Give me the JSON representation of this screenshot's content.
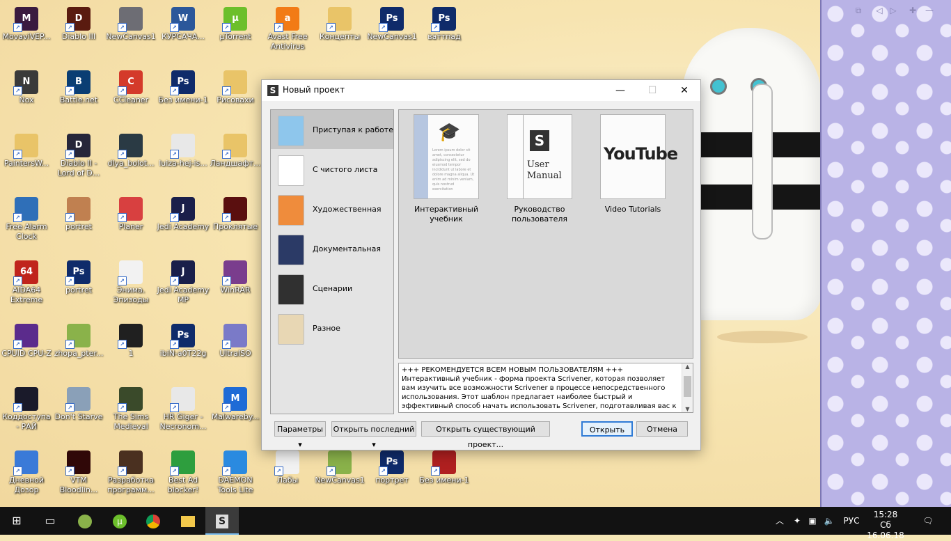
{
  "desktop": {
    "icons": [
      {
        "label": "MovaviVEP...",
        "glyph": "M",
        "color": "#3a1a3f"
      },
      {
        "label": "Diablo III",
        "glyph": "D",
        "color": "#5a1b10"
      },
      {
        "label": "NewCanvas1",
        "glyph": "",
        "color": "#6d6d74"
      },
      {
        "label": "КУРСАЧА...",
        "glyph": "W",
        "color": "#2b579a"
      },
      {
        "label": "µTorrent",
        "glyph": "µ",
        "color": "#6cbf2b"
      },
      {
        "label": "Avast Free Antivirus",
        "glyph": "a",
        "color": "#f27b16"
      },
      {
        "label": "Концепты",
        "glyph": "",
        "color": "#e9c468"
      },
      {
        "label": "NewCanvas1",
        "glyph": "Ps",
        "color": "#0f2b6a"
      },
      {
        "label": "ваттпад",
        "glyph": "Ps",
        "color": "#0f2b6a"
      },
      {
        "label": "Nox",
        "glyph": "N",
        "color": "#3a3a3a"
      },
      {
        "label": "Battle.net",
        "glyph": "B",
        "color": "#0b3e73"
      },
      {
        "label": "CCleaner",
        "glyph": "C",
        "color": "#d43a2a"
      },
      {
        "label": "Без имени-1",
        "glyph": "Ps",
        "color": "#0f2b6a"
      },
      {
        "label": "Рисовахи",
        "glyph": "",
        "color": "#e9c468"
      },
      {
        "label": "PaintersW...",
        "glyph": "",
        "color": "#e9c468"
      },
      {
        "label": "Diablo II - Lord of D...",
        "glyph": "D",
        "color": "#26263a"
      },
      {
        "label": "dlya_bolot...",
        "glyph": "",
        "color": "#2a3a44"
      },
      {
        "label": "luiza-hej-is...",
        "glyph": "",
        "color": "#e8e8e8"
      },
      {
        "label": "Ландшафт...",
        "glyph": "",
        "color": "#e9c468"
      },
      {
        "label": "Free Alarm Clock",
        "glyph": "",
        "color": "#2f6fb8"
      },
      {
        "label": "portret",
        "glyph": "",
        "color": "#c08050"
      },
      {
        "label": "Planer",
        "glyph": "",
        "color": "#d84040"
      },
      {
        "label": "Jedi Academy",
        "glyph": "J",
        "color": "#1a1f4a"
      },
      {
        "label": "Проклятые",
        "glyph": "",
        "color": "#5a0f0f"
      },
      {
        "label": "AIDA64 Extreme",
        "glyph": "64",
        "color": "#c0241c"
      },
      {
        "label": "portret",
        "glyph": "Ps",
        "color": "#0f2b6a"
      },
      {
        "label": "Энима. Эпизоды",
        "glyph": "",
        "color": "#f2f2f2"
      },
      {
        "label": "Jedi Academy MP",
        "glyph": "J",
        "color": "#1a1f4a"
      },
      {
        "label": "WinRAR",
        "glyph": "",
        "color": "#7a3d8d"
      },
      {
        "label": "CPUID CPU-Z",
        "glyph": "",
        "color": "#5b2b8c"
      },
      {
        "label": "zhopa_pter...",
        "glyph": "",
        "color": "#8ab24a"
      },
      {
        "label": "1",
        "glyph": "",
        "color": "#202020"
      },
      {
        "label": "ibiN-a0T22g",
        "glyph": "Ps",
        "color": "#0f2b6a"
      },
      {
        "label": "UltraISO",
        "glyph": "",
        "color": "#7a7ac8"
      },
      {
        "label": "Коддоступа - РАЙ",
        "glyph": "",
        "color": "#1a1a2a"
      },
      {
        "label": "Don't Starve",
        "glyph": "",
        "color": "#8aa0b8"
      },
      {
        "label": "The Sims Medieval",
        "glyph": "",
        "color": "#3a4a2a"
      },
      {
        "label": "HR Giger - Necronom...",
        "glyph": "",
        "color": "#e8e8e8"
      },
      {
        "label": "Malwareby...",
        "glyph": "M",
        "color": "#1e6bd6"
      },
      {
        "label": "Дневной Дозор",
        "glyph": "",
        "color": "#3a7ad8"
      },
      {
        "label": "VTM Bloodlin...",
        "glyph": "",
        "color": "#300808"
      },
      {
        "label": "Разработка программ...",
        "glyph": "",
        "color": "#4a3020"
      },
      {
        "label": "Best Ad blocker!",
        "glyph": "",
        "color": "#2e9e3e"
      },
      {
        "label": "DAEMON Tools Lite",
        "glyph": "",
        "color": "#2a8ae0"
      },
      {
        "label": "Лабы",
        "glyph": "",
        "color": "#f2f2f2"
      },
      {
        "label": "NewCanvas1",
        "glyph": "",
        "color": "#8ab24a"
      },
      {
        "label": "портрет",
        "glyph": "Ps",
        "color": "#0f2b6a"
      },
      {
        "label": "Без имени-1",
        "glyph": "",
        "color": "#b02020"
      }
    ]
  },
  "dialog": {
    "title": "Новый проект",
    "categories": [
      {
        "label": "Приступая к работе",
        "selected": true,
        "icon": "arrow-right-icon",
        "color": "#8ec6ec"
      },
      {
        "label": "С чистого листа",
        "selected": false,
        "icon": "blank-page-icon",
        "color": "#ffffff"
      },
      {
        "label": "Художественная",
        "selected": false,
        "icon": "fiction-book-icon",
        "color": "#ef8c3c"
      },
      {
        "label": "Документальная",
        "selected": false,
        "icon": "books-icon",
        "color": "#2b3a66"
      },
      {
        "label": "Сценарии",
        "selected": false,
        "icon": "clapperboard-icon",
        "color": "#303030"
      },
      {
        "label": "Разное",
        "selected": false,
        "icon": "notepad-icon",
        "color": "#e8d7b4"
      }
    ],
    "templates": [
      {
        "label": "Интерактивный учебник",
        "thumb_text": "Lorem ipsum dolor sit amet, consectetur adipiscing elit, sed do eiusmod tempor incididunt ut labore et dolore magna aliqua. Ut enim ad minim veniam, quis nostrud exercitation"
      },
      {
        "label": "Руководство пользователя",
        "thumb_text": "User Manual"
      },
      {
        "label": "Video Tutorials",
        "thumb_text": "YouTube"
      }
    ],
    "description": "+++ РЕКОМЕНДУЕТСЯ ВСЕМ НОВЫМ ПОЛЬЗОВАТЕЛЯМ +++ Интерактивный учебник - форма проекта Scrivener, которая позволяет вам изучить все возможности Scrivener в процессе непосредственного использования. Этот шаблон предлагает наиболее быстрый и эффективный способ начать использовать Scrivener, подготавливая вас к созданию",
    "buttons": {
      "options": "Параметры",
      "open_recent": "Открыть последний",
      "open_existing": "Открыть существующий проект...",
      "open": "Открыть",
      "cancel": "Отмена"
    }
  },
  "taskbar": {
    "lang": "РУС",
    "time": "15:28",
    "date": "Сб 16.06.18"
  },
  "colors": {
    "accent": "#2f7bd6",
    "taskbar": "#121212"
  }
}
